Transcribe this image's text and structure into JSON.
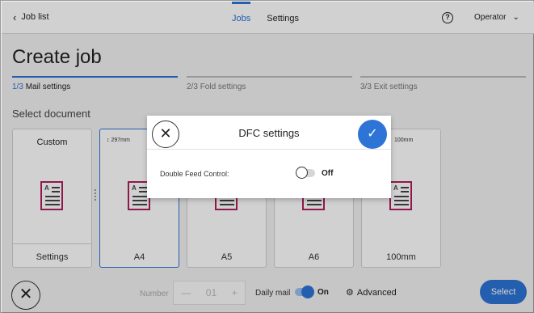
{
  "header": {
    "back_label": "Job list",
    "tabs": [
      {
        "label": "Jobs",
        "active": true
      },
      {
        "label": "Settings",
        "active": false
      }
    ],
    "help_icon": "question-circle-icon",
    "user_label": "Operator"
  },
  "page": {
    "title": "Create job",
    "steps": [
      {
        "num": "1/3",
        "label": "Mail settings",
        "active": true
      },
      {
        "num": "2/3",
        "label": "Fold settings",
        "active": false
      },
      {
        "num": "3/3",
        "label": "Exit settings",
        "active": false
      }
    ],
    "section_label": "Select document"
  },
  "documents": [
    {
      "top": "Custom",
      "caption": "Settings",
      "selected": false
    },
    {
      "top": "↕ 297mm",
      "caption": "A4",
      "selected": true
    },
    {
      "top": "",
      "caption": "A5",
      "selected": false
    },
    {
      "top": "",
      "caption": "A6",
      "selected": false
    },
    {
      "top": "100mm",
      "caption": "100mm",
      "selected": false
    }
  ],
  "bottom": {
    "number_label": "Number",
    "number_minus": "—",
    "number_value": "01",
    "number_plus": "+",
    "daily_mail_label": "Daily mail",
    "daily_mail_state": "On",
    "advanced_label": "Advanced",
    "select_label": "Select"
  },
  "modal": {
    "title": "DFC settings",
    "close_symbol": "✕",
    "confirm_symbol": "✓",
    "setting_label": "Double Feed Control:",
    "setting_state": "Off"
  },
  "colors": {
    "accent": "#2d74d6",
    "document_icon": "#b01e5e"
  }
}
